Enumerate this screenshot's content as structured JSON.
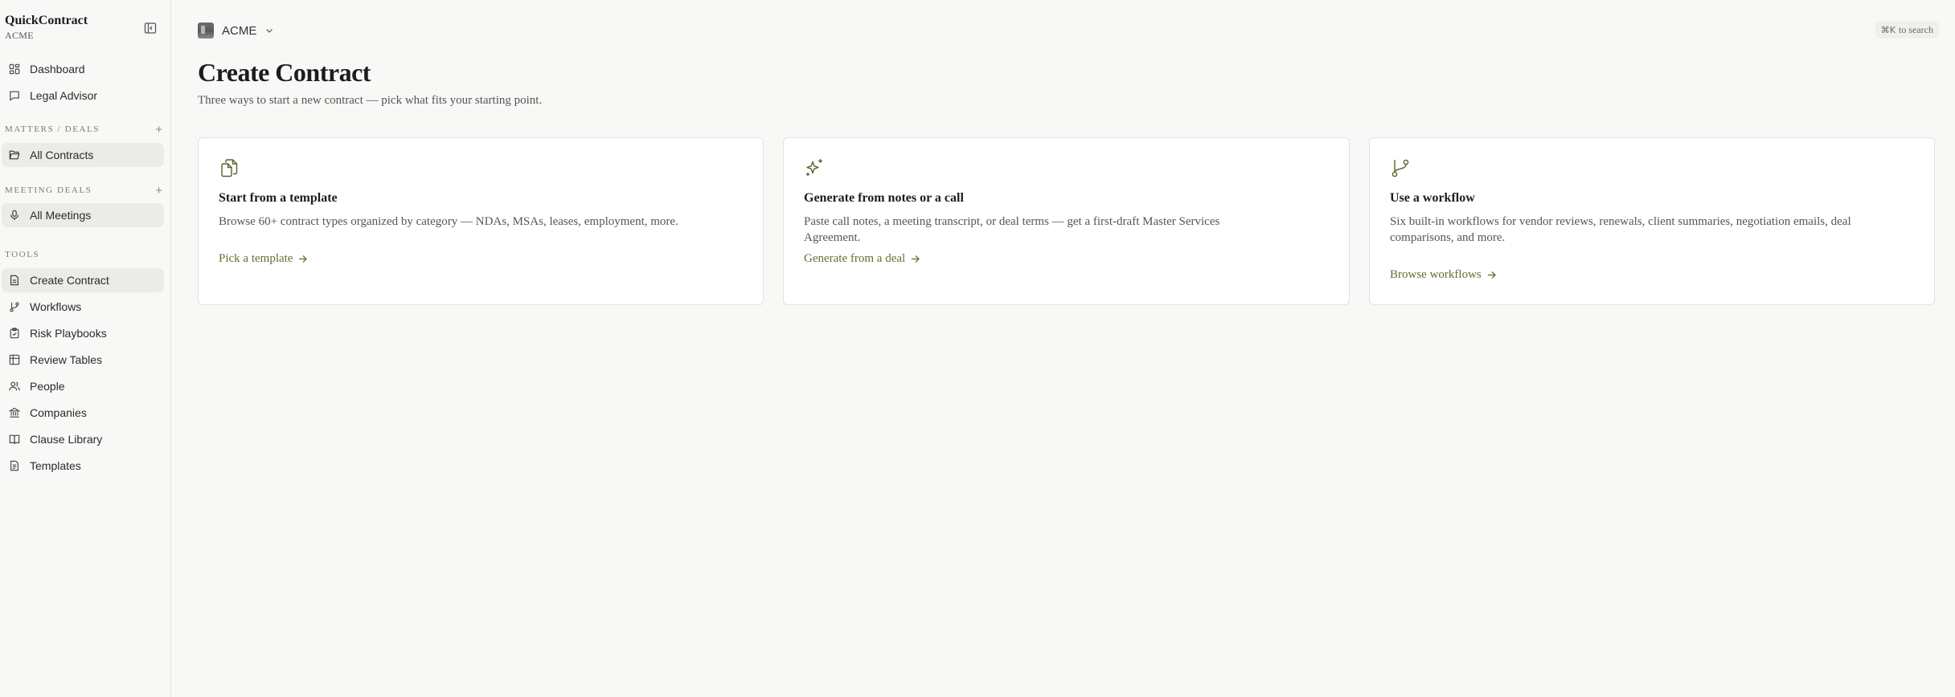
{
  "sidebar": {
    "brand": "QuickContract",
    "org": "ACME",
    "top_items": [
      {
        "label": "Dashboard",
        "icon": "dashboard-icon"
      },
      {
        "label": "Legal Advisor",
        "icon": "chat-icon"
      }
    ],
    "matters_section": {
      "title": "MATTERS / DEALS",
      "items": [
        {
          "label": "All Contracts",
          "icon": "folder-open-icon"
        }
      ]
    },
    "meetings_section": {
      "title": "MEETING DEALS",
      "items": [
        {
          "label": "All Meetings",
          "icon": "microphone-icon"
        }
      ]
    },
    "tools_section": {
      "title": "TOOLS",
      "items": [
        {
          "label": "Create Contract",
          "icon": "file-text-icon"
        },
        {
          "label": "Workflows",
          "icon": "git-branch-icon"
        },
        {
          "label": "Risk Playbooks",
          "icon": "clipboard-check-icon"
        },
        {
          "label": "Review Tables",
          "icon": "table-icon"
        },
        {
          "label": "People",
          "icon": "users-icon"
        },
        {
          "label": "Companies",
          "icon": "bank-icon"
        },
        {
          "label": "Clause Library",
          "icon": "book-icon"
        },
        {
          "label": "Templates",
          "icon": "file-icon"
        }
      ]
    }
  },
  "topbar": {
    "org_name": "ACME",
    "search_hint_key": "⌘K",
    "search_hint_text": "to search"
  },
  "main": {
    "title": "Create Contract",
    "subtitle": "Three ways to start a new contract — pick what fits your starting point.",
    "cards": [
      {
        "title": "Start from a template",
        "description": "Browse 60+ contract types organized by category — NDAs, MSAs, leases, employment, more.",
        "link": "Pick a template",
        "icon": "copy-icon"
      },
      {
        "title": "Generate from notes or a call",
        "description": "Paste call notes, a meeting transcript, or deal terms — get a first-draft Master Services Agreement.",
        "link": "Generate from a deal",
        "icon": "sparkles-icon"
      },
      {
        "title": "Use a workflow",
        "description": "Six built-in workflows for vendor reviews, renewals, client summaries, negotiation emails, deal comparisons, and more.",
        "link": "Browse workflows",
        "icon": "git-branch-icon"
      }
    ]
  },
  "colors": {
    "accent_link": "#6b6b33",
    "icon_olive": "#5f5f2f",
    "active_bg": "#ebebe8"
  }
}
